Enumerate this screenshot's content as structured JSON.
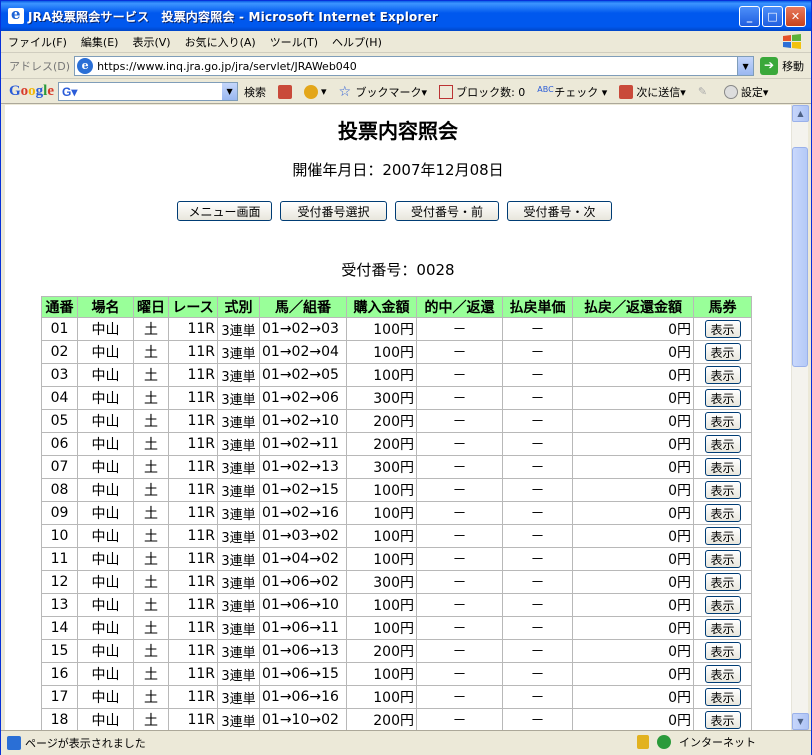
{
  "window": {
    "title": "JRA投票照会サービス　投票内容照会 - Microsoft Internet Explorer",
    "minimize_glyph": "_",
    "maximize_glyph": "□",
    "close_glyph": "✕"
  },
  "menubar": {
    "items": [
      "ファイル(F)",
      "編集(E)",
      "表示(V)",
      "お気に入り(A)",
      "ツール(T)",
      "ヘルプ(H)"
    ]
  },
  "addressbar": {
    "label": "アドレス(D)",
    "url": "https://www.inq.jra.go.jp/jra/servlet/JRAWeb040",
    "go_label": "移動"
  },
  "google_toolbar": {
    "search_label": "検索",
    "bookmark_label": "ブックマーク▾",
    "popup_block_label": "ブロック数: 0",
    "check_label": "チェック ▾",
    "send_label": "次に送信▾",
    "settings_label": "設定▾"
  },
  "page": {
    "title": "投票内容照会",
    "date_label": "開催年月日：2007年12月08日",
    "buttons": {
      "menu": "メニュー画面",
      "receipt_select": "受付番号選択",
      "receipt_prev": "受付番号・前",
      "receipt_next": "受付番号・次"
    },
    "receipt_label": "受付番号：0028"
  },
  "table": {
    "headers": [
      "通番",
      "場名",
      "曜日",
      "レース",
      "式別",
      "馬／組番",
      "購入金額",
      "的中／返還",
      "払戻単価",
      "払戻／返還金額",
      "馬券"
    ],
    "show_label": "表示",
    "rows": [
      [
        "01",
        "中山",
        "土",
        "11R",
        "3連単",
        "01→02→03",
        "100円",
        "－",
        "－",
        "0円"
      ],
      [
        "02",
        "中山",
        "土",
        "11R",
        "3連単",
        "01→02→04",
        "100円",
        "－",
        "－",
        "0円"
      ],
      [
        "03",
        "中山",
        "土",
        "11R",
        "3連単",
        "01→02→05",
        "100円",
        "－",
        "－",
        "0円"
      ],
      [
        "04",
        "中山",
        "土",
        "11R",
        "3連単",
        "01→02→06",
        "300円",
        "－",
        "－",
        "0円"
      ],
      [
        "05",
        "中山",
        "土",
        "11R",
        "3連単",
        "01→02→10",
        "200円",
        "－",
        "－",
        "0円"
      ],
      [
        "06",
        "中山",
        "土",
        "11R",
        "3連単",
        "01→02→11",
        "200円",
        "－",
        "－",
        "0円"
      ],
      [
        "07",
        "中山",
        "土",
        "11R",
        "3連単",
        "01→02→13",
        "300円",
        "－",
        "－",
        "0円"
      ],
      [
        "08",
        "中山",
        "土",
        "11R",
        "3連単",
        "01→02→15",
        "100円",
        "－",
        "－",
        "0円"
      ],
      [
        "09",
        "中山",
        "土",
        "11R",
        "3連単",
        "01→02→16",
        "100円",
        "－",
        "－",
        "0円"
      ],
      [
        "10",
        "中山",
        "土",
        "11R",
        "3連単",
        "01→03→02",
        "100円",
        "－",
        "－",
        "0円"
      ],
      [
        "11",
        "中山",
        "土",
        "11R",
        "3連単",
        "01→04→02",
        "100円",
        "－",
        "－",
        "0円"
      ],
      [
        "12",
        "中山",
        "土",
        "11R",
        "3連単",
        "01→06→02",
        "300円",
        "－",
        "－",
        "0円"
      ],
      [
        "13",
        "中山",
        "土",
        "11R",
        "3連単",
        "01→06→10",
        "100円",
        "－",
        "－",
        "0円"
      ],
      [
        "14",
        "中山",
        "土",
        "11R",
        "3連単",
        "01→06→11",
        "100円",
        "－",
        "－",
        "0円"
      ],
      [
        "15",
        "中山",
        "土",
        "11R",
        "3連単",
        "01→06→13",
        "200円",
        "－",
        "－",
        "0円"
      ],
      [
        "16",
        "中山",
        "土",
        "11R",
        "3連単",
        "01→06→15",
        "100円",
        "－",
        "－",
        "0円"
      ],
      [
        "17",
        "中山",
        "土",
        "11R",
        "3連単",
        "01→06→16",
        "100円",
        "－",
        "－",
        "0円"
      ],
      [
        "18",
        "中山",
        "土",
        "11R",
        "3連単",
        "01→10→02",
        "200円",
        "－",
        "－",
        "0円"
      ]
    ]
  },
  "statusbar": {
    "text": "ページが表示されました",
    "zone": "インターネット"
  },
  "colors": {
    "header_bg": "#99ff99",
    "titlebar": "#0058ee"
  }
}
